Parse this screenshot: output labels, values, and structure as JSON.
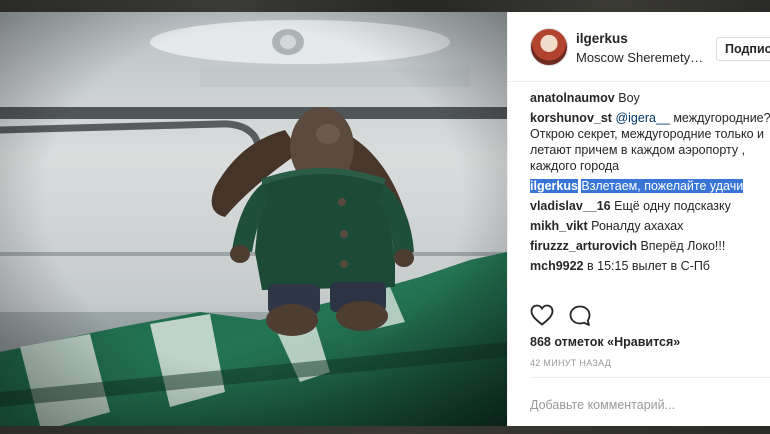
{
  "post": {
    "username": "ilgerkus",
    "location": "Moscow Sheremetyevo International Airport",
    "follow_label": "Подписаться",
    "likes": "868 отметок «Нравится»",
    "time": "42 МИНУТ НАЗАД",
    "comment_placeholder": "Добавьте комментарий..."
  },
  "comments": [
    {
      "user": "anatolnaumov",
      "text": "Boy"
    },
    {
      "user": "korshunov_st",
      "mention": "@igera__",
      "text": " междугородние? Открою секрет, междугородние только и летают причем в каждом аэропорту , каждого города"
    },
    {
      "user": "ilgerkus",
      "text": "Взлетаем, пожелайте удачи"
    },
    {
      "user": "vladislav__16",
      "text": "Ещё одну подсказку"
    },
    {
      "user": "mikh_vikt",
      "text": "Роналду ахахах"
    },
    {
      "user": "firuzzz_arturovich",
      "text": "Вперёд Локо!!!"
    },
    {
      "user": "mch9922",
      "text": "в 15:15 вылет в С-Пб"
    }
  ],
  "icons": {
    "like": "heart-outline-icon",
    "comment": "speech-bubble-icon"
  },
  "colors": {
    "selection": "#3875d7",
    "jersey_green": "#1f6b4a",
    "sweater_green": "#1d4a37"
  }
}
